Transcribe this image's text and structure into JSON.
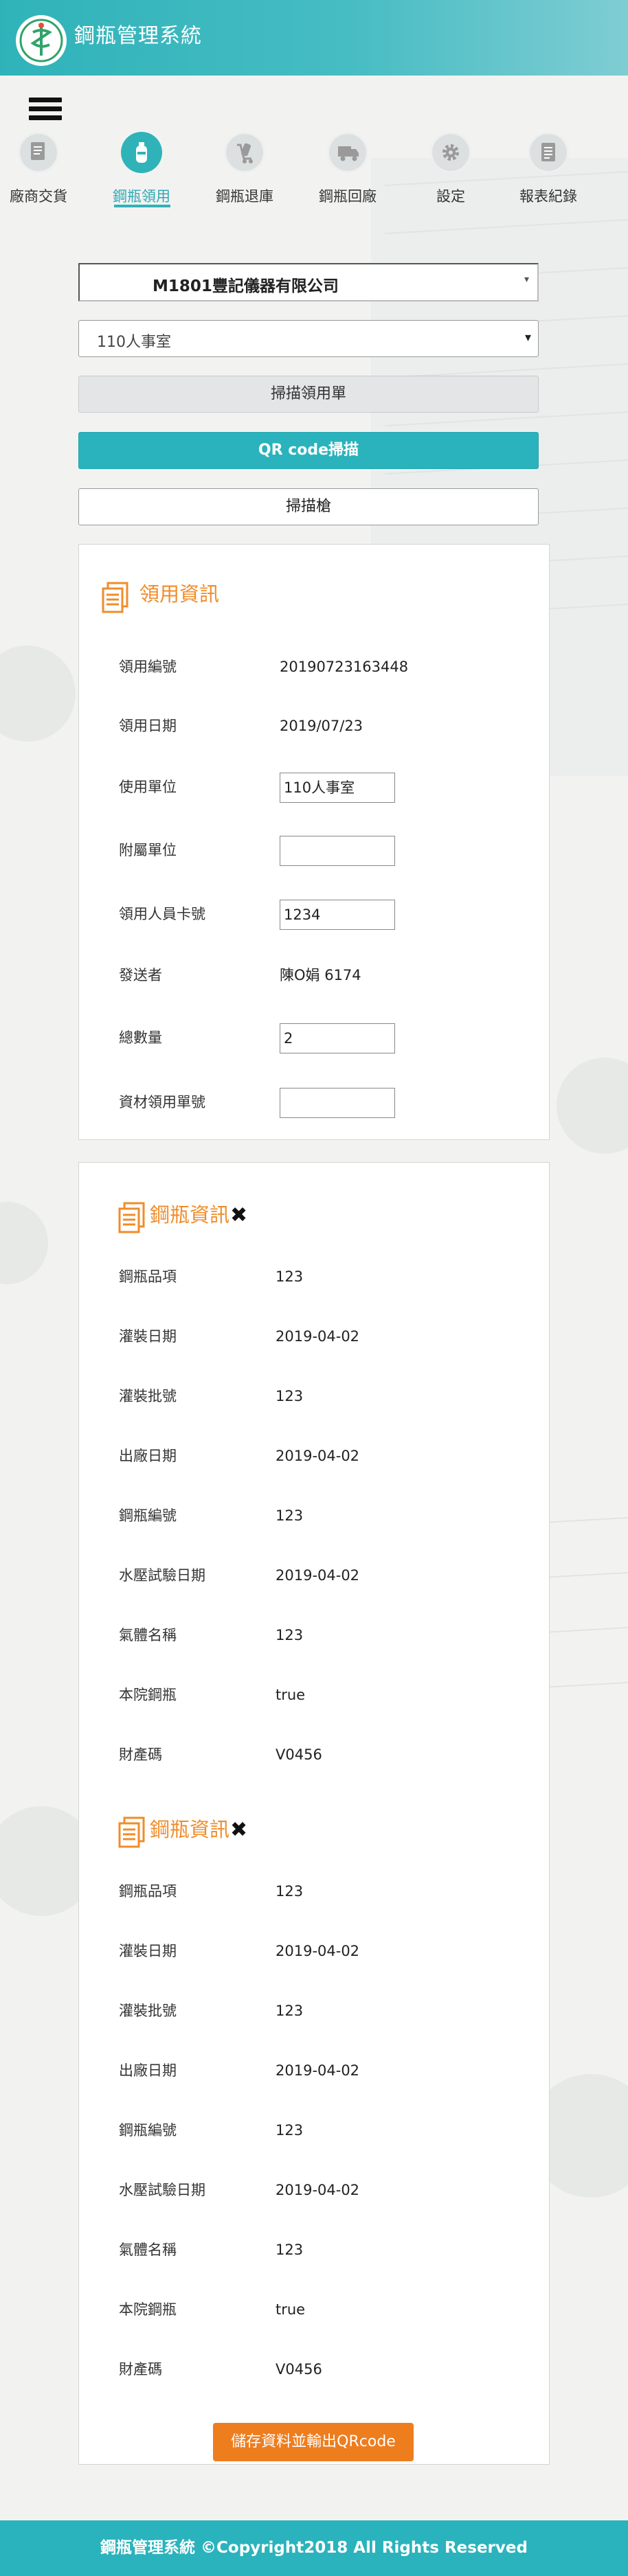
{
  "app": {
    "title": "鋼瓶管理系統"
  },
  "nav": {
    "items": [
      {
        "label": "廠商交貨",
        "icon": "delivery-doc-icon"
      },
      {
        "label": "鋼瓶領用",
        "icon": "gas-cylinder-icon",
        "active": true
      },
      {
        "label": "鋼瓶退庫",
        "icon": "cart-return-icon"
      },
      {
        "label": "鋼瓶回廠",
        "icon": "truck-icon"
      },
      {
        "label": "設定",
        "icon": "gear-icon"
      },
      {
        "label": "報表紀錄",
        "icon": "report-icon"
      }
    ]
  },
  "form": {
    "vendor_select": "M1801豐記儀器有限公司",
    "unit_select": "110人事室",
    "scan_form_button": "掃描領用單",
    "qr_scan_button": "QR code掃描",
    "scanner_button": "掃描槍"
  },
  "requisition": {
    "title": "領用資訊",
    "fields": {
      "number_label": "領用編號",
      "number_value": "20190723163448",
      "date_label": "領用日期",
      "date_value": "2019/07/23",
      "unit_label": "使用單位",
      "unit_value": "110人事室",
      "sub_unit_label": "附屬單位",
      "sub_unit_value": "",
      "card_label": "領用人員卡號",
      "card_value": "1234",
      "sender_label": "發送者",
      "sender_value": "陳O娟 6174",
      "total_label": "總數量",
      "total_value": "2",
      "material_label": "資材領用單號",
      "material_value": ""
    }
  },
  "cylinders": [
    {
      "title": "鋼瓶資訊",
      "rows": [
        {
          "label": "鋼瓶品項",
          "value": "123"
        },
        {
          "label": "灌裝日期",
          "value": "2019-04-02"
        },
        {
          "label": "灌裝批號",
          "value": "123"
        },
        {
          "label": "出廠日期",
          "value": "2019-04-02"
        },
        {
          "label": "鋼瓶編號",
          "value": "123"
        },
        {
          "label": "水壓試驗日期",
          "value": "2019-04-02"
        },
        {
          "label": "氣體名稱",
          "value": "123"
        },
        {
          "label": "本院鋼瓶",
          "value": "true"
        },
        {
          "label": "財產碼",
          "value": "V0456"
        }
      ]
    },
    {
      "title": "鋼瓶資訊",
      "rows": [
        {
          "label": "鋼瓶品項",
          "value": "123"
        },
        {
          "label": "灌裝日期",
          "value": "2019-04-02"
        },
        {
          "label": "灌裝批號",
          "value": "123"
        },
        {
          "label": "出廠日期",
          "value": "2019-04-02"
        },
        {
          "label": "鋼瓶編號",
          "value": "123"
        },
        {
          "label": "水壓試驗日期",
          "value": "2019-04-02"
        },
        {
          "label": "氣體名稱",
          "value": "123"
        },
        {
          "label": "本院鋼瓶",
          "value": "true"
        },
        {
          "label": "財產碼",
          "value": "V0456"
        }
      ]
    }
  ],
  "save_button": "儲存資料並輸出QRcode",
  "footer": "鋼瓶管理系統 ©Copyright2018 All Rights Reserved",
  "colors": {
    "primary": "#2ab3bc",
    "accent": "#f08c2a",
    "save": "#ee7d1e"
  }
}
